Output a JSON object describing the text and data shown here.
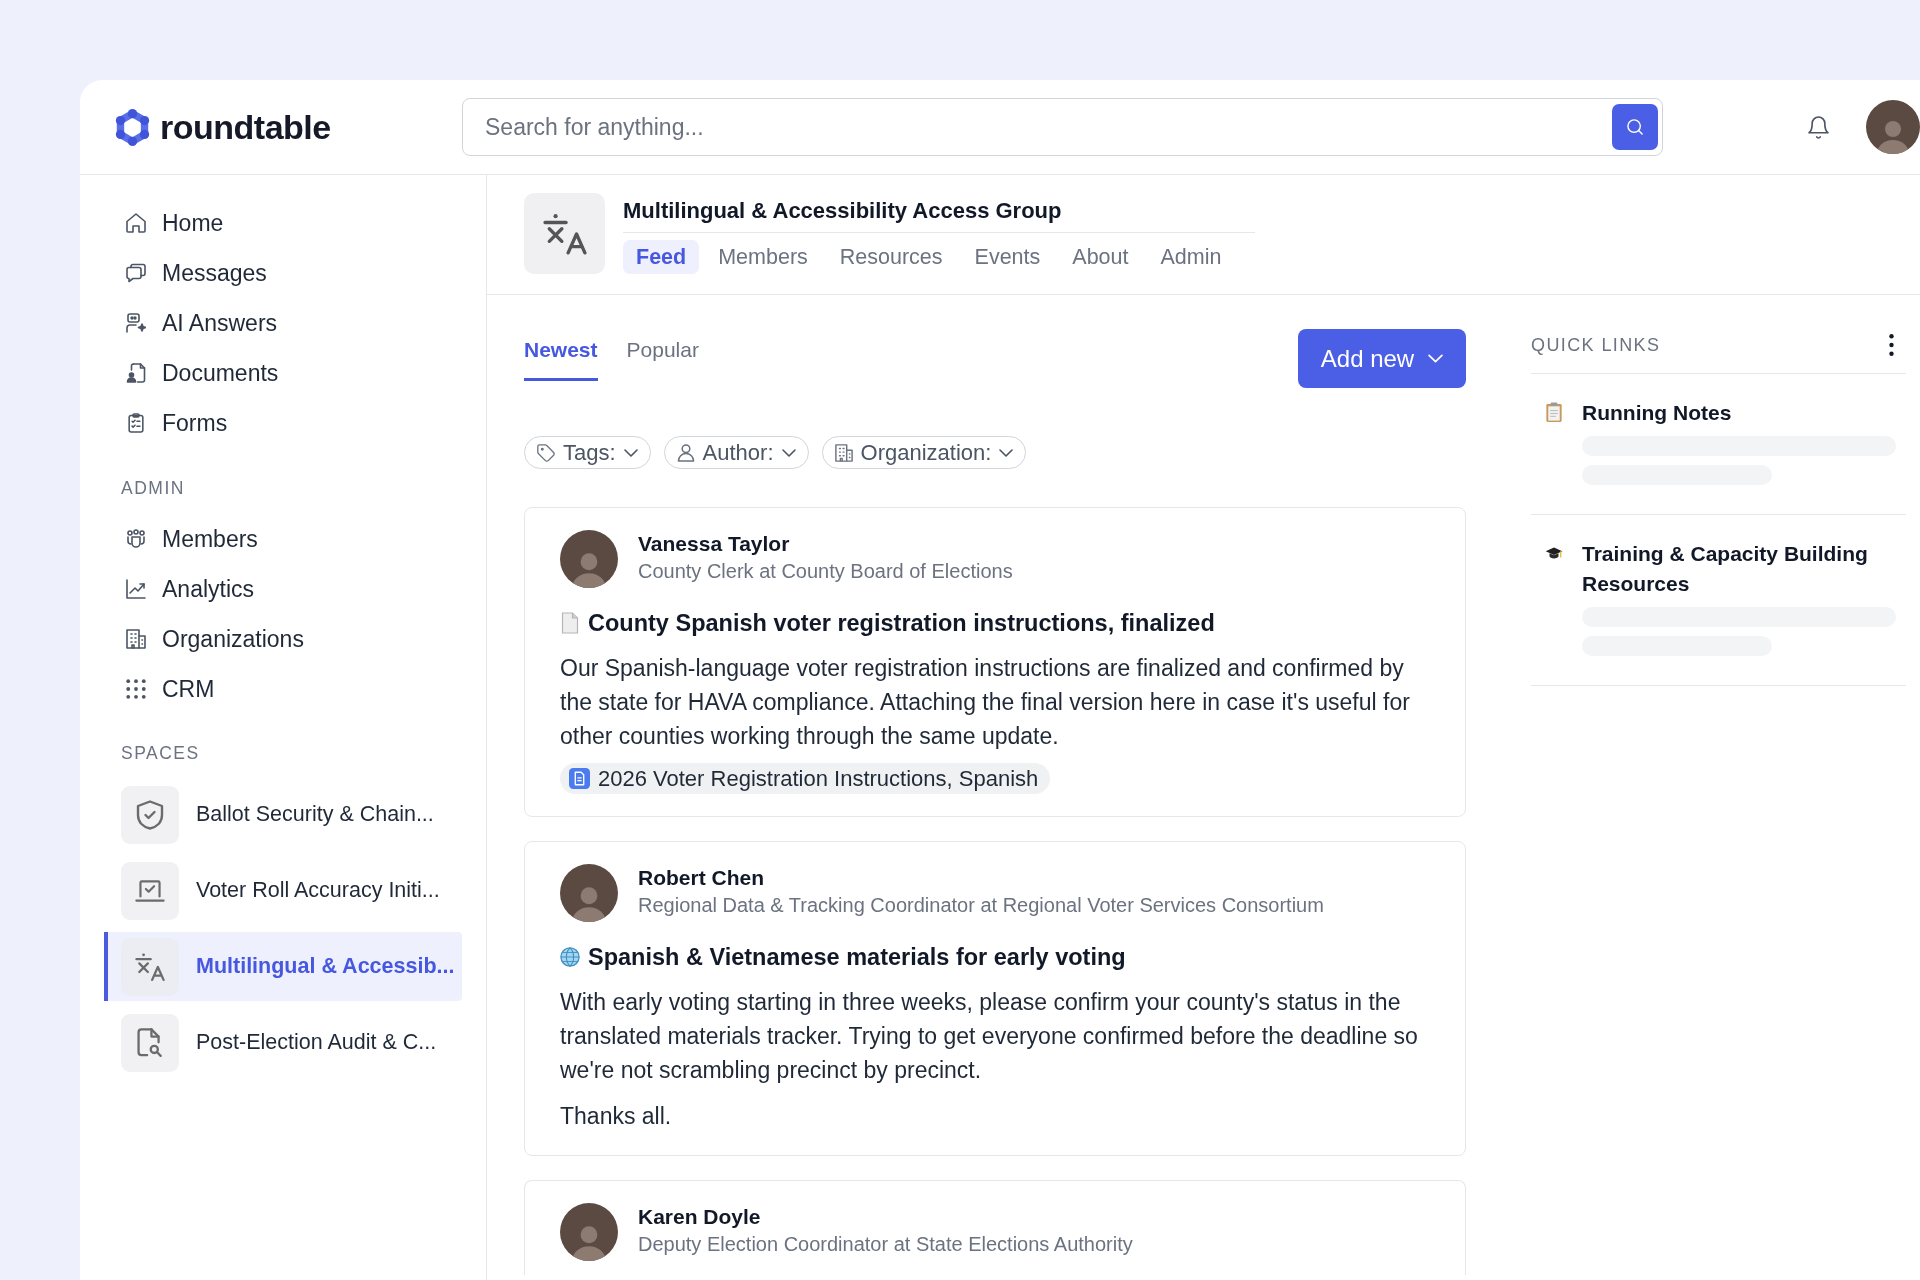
{
  "header": {
    "logo": "roundtable",
    "search": {
      "placeholder": "Search for anything..."
    }
  },
  "sidebar": {
    "main_items": [
      {
        "label": "Home",
        "selected": false
      },
      {
        "label": "Messages",
        "selected": false
      },
      {
        "label": "AI Answers",
        "selected": false
      },
      {
        "label": "Documents",
        "selected": false
      },
      {
        "label": "Forms",
        "selected": false
      }
    ],
    "admin": {
      "title": "ADMIN",
      "items": [
        {
          "label": "Members",
          "selected": false
        },
        {
          "label": "Analytics",
          "selected": false
        },
        {
          "label": "Organizations",
          "selected": false
        },
        {
          "label": "CRM",
          "selected": false
        }
      ]
    },
    "spaces": {
      "title": "SPACES",
      "items": [
        {
          "label": "Ballot Security & Chain...",
          "selected": false
        },
        {
          "label": "Voter Roll Accuracy Initi...",
          "selected": false
        },
        {
          "label": "Multilingual & Accessib...",
          "selected": true
        },
        {
          "label": "Post-Election Audit & C...",
          "selected": false
        }
      ]
    }
  },
  "group": {
    "title": "Multilingual & Accessibility Access Group",
    "tabs": [
      {
        "label": "Feed",
        "selected": true
      },
      {
        "label": "Members",
        "selected": false
      },
      {
        "label": "Resources",
        "selected": false
      },
      {
        "label": "Events",
        "selected": false
      },
      {
        "label": "About",
        "selected": false
      },
      {
        "label": "Admin",
        "selected": false
      }
    ]
  },
  "feed": {
    "sort_tabs": [
      {
        "label": "Newest",
        "selected": true
      },
      {
        "label": "Popular",
        "selected": false
      }
    ],
    "add_button": "Add new",
    "filters": [
      "Tags:",
      "Author:",
      "Organization:"
    ],
    "posts": [
      {
        "author": "Vanessa Taylor",
        "role": "County Clerk at County Board of Elections",
        "title": "County Spanish voter registration instructions, finalized",
        "paragraphs": [
          "Our Spanish-language voter registration instructions are finalized and confirmed by the state for HAVA compliance. Attaching the final version here in case it's useful for other counties working through the same update."
        ],
        "attachment": "2026 Voter Registration Instructions, Spanish"
      },
      {
        "author": "Robert Chen",
        "role": "Regional Data & Tracking Coordinator at Regional Voter Services Consortium",
        "title": "Spanish & Vietnamese materials for early voting",
        "paragraphs": [
          "With early voting starting in three weeks, please confirm your county's status in the translated materials tracker. Trying to get everyone confirmed before the deadline so we're not scrambling precinct by precinct.",
          "Thanks all."
        ]
      },
      {
        "author": "Karen Doyle",
        "role": "Deputy Election Coordinator at State Elections Authority"
      }
    ]
  },
  "quick_links": {
    "title": "QUICK LINKS",
    "items": [
      {
        "title": "Running Notes"
      },
      {
        "title": "Training & Capacity Building Resources"
      }
    ]
  }
}
